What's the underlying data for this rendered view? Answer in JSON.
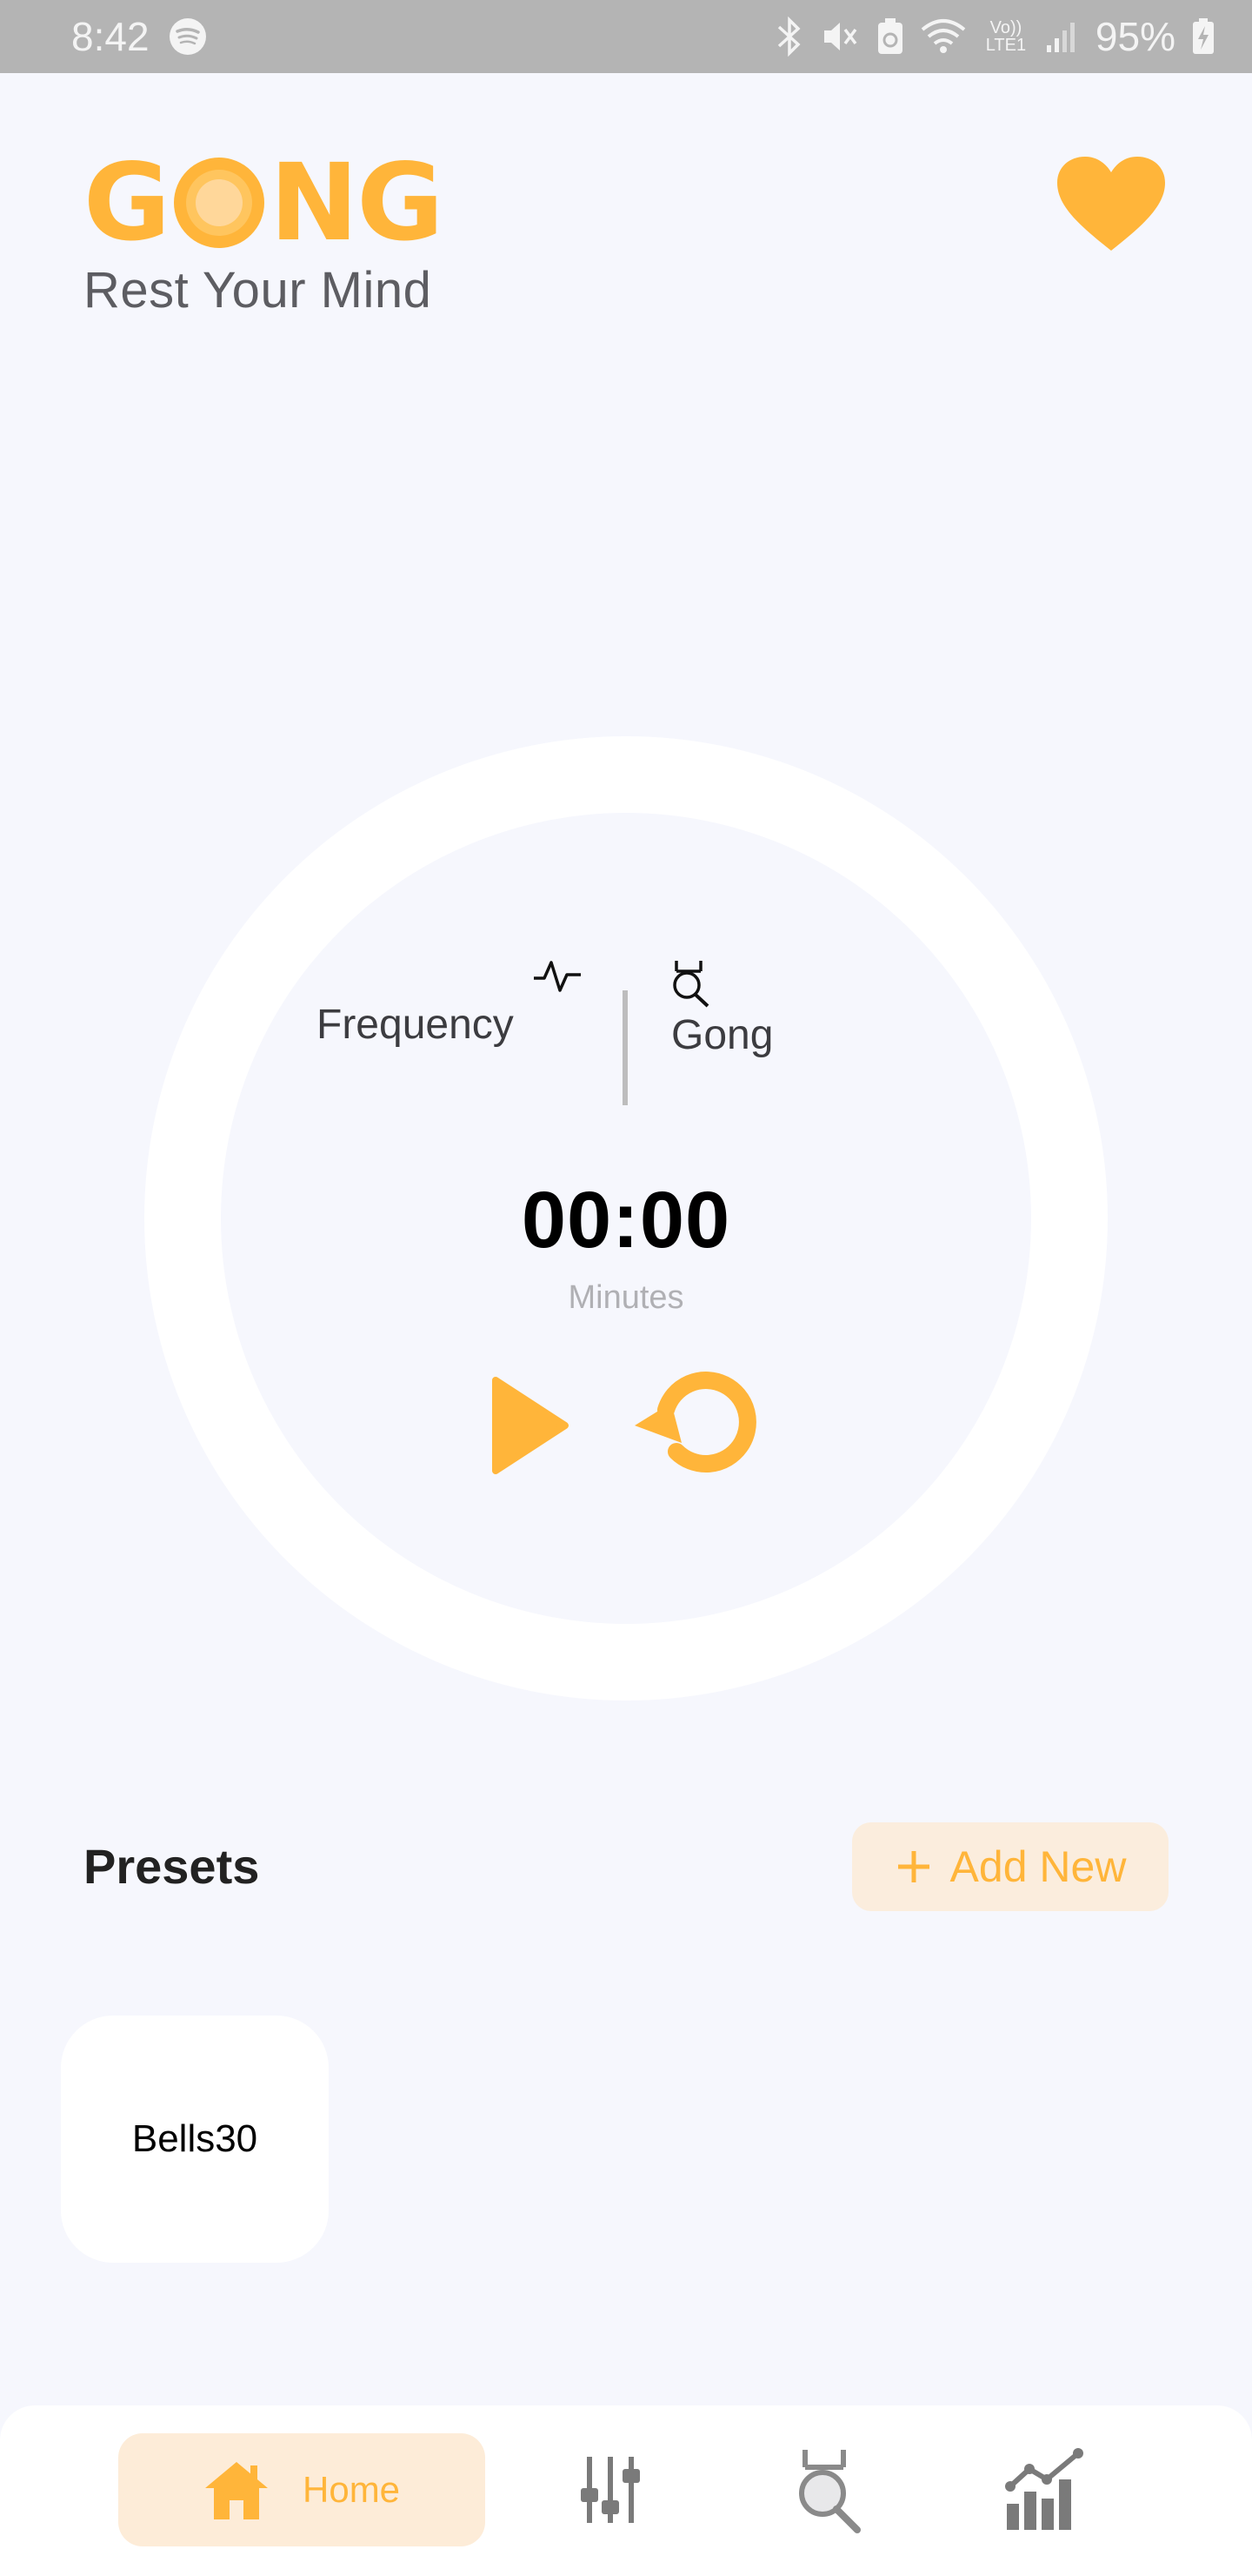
{
  "status_bar": {
    "time": "8:42",
    "battery": "95%",
    "network": "Vo)) LTE1",
    "icons": [
      "spotify-icon",
      "bluetooth-icon",
      "mute-icon",
      "recycle-icon",
      "wifi-icon",
      "signal-icon",
      "battery-charging-icon"
    ]
  },
  "header": {
    "logo_text_left": "G",
    "logo_text_right": "NG",
    "tagline": "Rest Your Mind",
    "favorite_icon": "heart-icon"
  },
  "timer": {
    "frequency_label": "Frequency",
    "frequency_icon": "pulse-icon",
    "gong_label": "Gong",
    "gong_icon": "gong-icon",
    "value": "00:00",
    "unit": "Minutes",
    "play_icon": "play-icon",
    "reset_icon": "reset-icon"
  },
  "presets": {
    "title": "Presets",
    "add_new_label": "Add New",
    "items": [
      {
        "label": "Bells30"
      }
    ]
  },
  "bottom_nav": {
    "items": [
      {
        "label": "Home",
        "icon": "home-icon",
        "active": true
      },
      {
        "label": "",
        "icon": "mixer-icon",
        "active": false
      },
      {
        "label": "",
        "icon": "gong-icon",
        "active": false
      },
      {
        "label": "",
        "icon": "stats-icon",
        "active": false
      }
    ]
  },
  "colors": {
    "accent": "#ffb53a",
    "background": "#f6f7fd",
    "status_bar": "#b4b4b4",
    "active_nav_bg": "#fdecd8"
  }
}
